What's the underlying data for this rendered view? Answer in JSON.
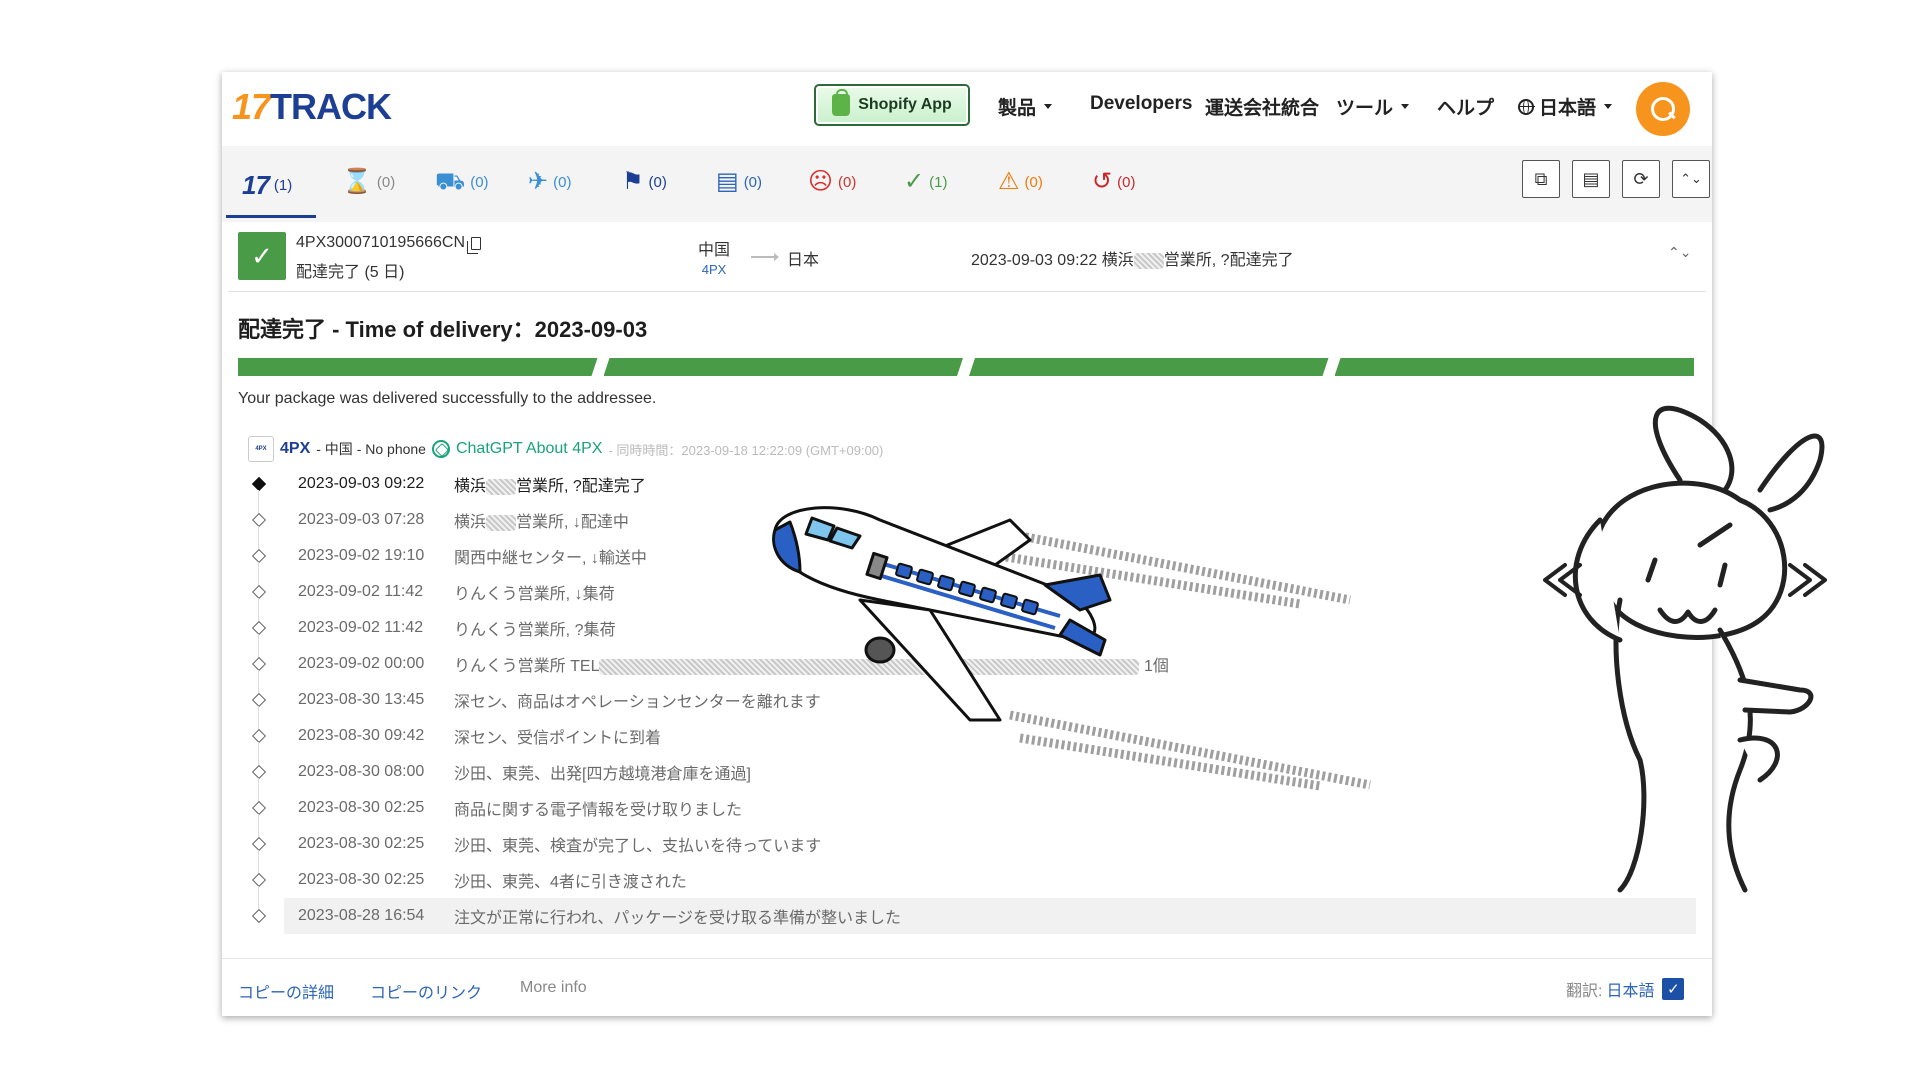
{
  "header": {
    "logo_num": "17",
    "logo_text": "TRACK",
    "shopify_label": "Shopify App",
    "nav": [
      "製品",
      "Developers",
      "運送会社統合",
      "ツール",
      "ヘルプ",
      "日本語"
    ]
  },
  "tabs": [
    {
      "icon": "17",
      "count": "(1)"
    },
    {
      "icon": "hourglass-icon",
      "count": "(0)"
    },
    {
      "icon": "truck-clock-icon",
      "count": "(0)"
    },
    {
      "icon": "airplane-icon",
      "count": "(0)"
    },
    {
      "icon": "flag-icon",
      "count": "(0)"
    },
    {
      "icon": "package-hand-icon",
      "count": "(0)"
    },
    {
      "icon": "sad-face-icon",
      "count": "(0)"
    },
    {
      "icon": "check-icon",
      "count": "(1)"
    },
    {
      "icon": "warning-icon",
      "count": "(0)"
    },
    {
      "icon": "history-icon",
      "count": "(0)"
    }
  ],
  "shipment": {
    "tracking_number": "4PX3000710195666CN",
    "status": "配達完了 (5 日)",
    "origin": "中国",
    "carrier_code": "4PX",
    "destination": "日本",
    "last_event": "2023-09-03 09:22  横浜",
    "last_event_tail": "営業所, ?配達完了"
  },
  "delivery": {
    "heading": "配達完了 - Time of delivery：2023-09-03",
    "message": "Your package was delivered successfully to the addressee.",
    "progress_segments": 4
  },
  "carrier": {
    "logo": "4PX",
    "name": "4PX",
    "info": "- 中国 - No phone",
    "gpt_label": "ChatGPT About 4PX",
    "sync": "- 同時時間：2023-09-18 12:22:09 (GMT+09:00)"
  },
  "events": [
    {
      "time": "2023-09-03 09:22",
      "desc": "横浜",
      "tail": "営業所, ?配達完了"
    },
    {
      "time": "2023-09-03 07:28",
      "desc": "横浜",
      "tail": "営業所, ↓配達中"
    },
    {
      "time": "2023-09-02 19:10",
      "desc": "関西中継センター, ↓輸送中",
      "tail": ""
    },
    {
      "time": "2023-09-02 11:42",
      "desc": "りんくう営業所, ↓集荷",
      "tail": ""
    },
    {
      "time": "2023-09-02 11:42",
      "desc": "りんくう営業所, ?集荷",
      "tail": ""
    },
    {
      "time": "2023-09-02 00:00",
      "desc": "りんくう営業所 TEL",
      "tail": "1個"
    },
    {
      "time": "2023-08-30 13:45",
      "desc": "深セン、商品はオペレーションセンターを離れます",
      "tail": ""
    },
    {
      "time": "2023-08-30 09:42",
      "desc": "深セン、受信ポイントに到着",
      "tail": ""
    },
    {
      "time": "2023-08-30 08:00",
      "desc": "沙田、東莞、出発[四方越境港倉庫を通過]",
      "tail": ""
    },
    {
      "time": "2023-08-30 02:25",
      "desc": "商品に関する電子情報を受け取りました",
      "tail": ""
    },
    {
      "time": "2023-08-30 02:25",
      "desc": "沙田、東莞、検査が完了し、支払いを待っています",
      "tail": ""
    },
    {
      "time": "2023-08-30 02:25",
      "desc": "沙田、東莞、4者に引き渡された",
      "tail": ""
    },
    {
      "time": "2023-08-28 16:54",
      "desc": "注文が正常に行われ、パッケージを受け取る準備が整いました",
      "tail": ""
    }
  ],
  "footer": {
    "copy_detail": "コピーの詳細",
    "copy_link": "コピーのリンク",
    "more_info": "More info",
    "translate_label": "翻訳:",
    "translate_value": "日本語"
  },
  "colors": {
    "brand_orange": "#f7941d",
    "brand_blue": "#1c3f94",
    "success_green": "#4a9b48",
    "link_blue": "#2c65b8"
  }
}
